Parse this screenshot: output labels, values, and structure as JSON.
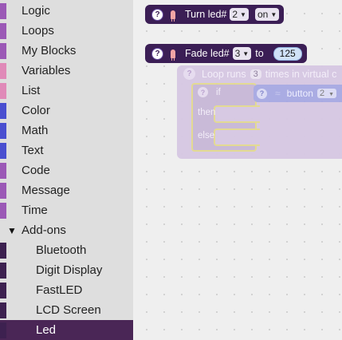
{
  "toolbox": {
    "categories": [
      {
        "label": "Logic",
        "color": "#9b59b6"
      },
      {
        "label": "Loops",
        "color": "#9b59b6"
      },
      {
        "label": "My Blocks",
        "color": "#9b59b6"
      },
      {
        "label": "Variables",
        "color": "#e08ab8"
      },
      {
        "label": "List",
        "color": "#e08ab8"
      },
      {
        "label": "Color",
        "color": "#4a4fd0"
      },
      {
        "label": "Math",
        "color": "#4a4fd0"
      },
      {
        "label": "Text",
        "color": "#4a4fd0"
      },
      {
        "label": "Code",
        "color": "#9b59b6"
      },
      {
        "label": "Message",
        "color": "#9b59b6"
      },
      {
        "label": "Time",
        "color": "#9b59b6"
      }
    ],
    "addons": {
      "label": "Add-ons",
      "arrow": "▼",
      "color": "#3d2150",
      "items": [
        {
          "label": "Bluetooth",
          "color": "#3d2150"
        },
        {
          "label": "Digit Display",
          "color": "#3d2150"
        },
        {
          "label": "FastLED",
          "color": "#3d2150"
        },
        {
          "label": "LCD Screen",
          "color": "#3d2150"
        },
        {
          "label": "Led",
          "color": "#3d2150",
          "selected": true
        }
      ]
    }
  },
  "workspace": {
    "turn_block": {
      "help": "?",
      "text": "Turn led#",
      "led_value": "2",
      "state_value": "on",
      "caret": "▼"
    },
    "fade_block": {
      "help": "?",
      "text": "Fade led#",
      "led_value": "3",
      "to_text": "to",
      "value": "125",
      "caret": "▼"
    },
    "ghost_loop": {
      "help": "?",
      "text_prefix": "Loop runs",
      "count": "3",
      "text_suffix": "times in virtual c",
      "if_help": "?",
      "if_label": "if",
      "then_label": "then",
      "else_label": "else",
      "cond_help": "?",
      "cond_wave": "≈",
      "cond_label": "button",
      "cond_value": "2",
      "caret": "▼"
    }
  }
}
